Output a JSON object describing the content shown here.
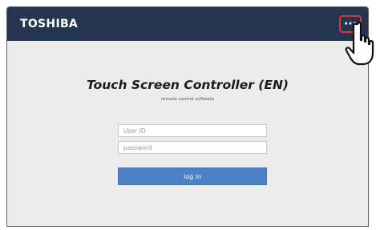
{
  "header": {
    "brand": "TOSHIBA",
    "menu_label": "···"
  },
  "login": {
    "title": "Touch Screen Controller (EN)",
    "subtitle": "remote control software",
    "userid_placeholder": "User ID",
    "password_placeholder": "password",
    "login_label": "log in"
  },
  "colors": {
    "header_bg": "#25344f",
    "highlight": "#e03030",
    "login_button": "#4a82c5",
    "page_bg": "#ececec"
  },
  "icons": [
    "more-menu-icon",
    "pointing-hand-icon"
  ]
}
